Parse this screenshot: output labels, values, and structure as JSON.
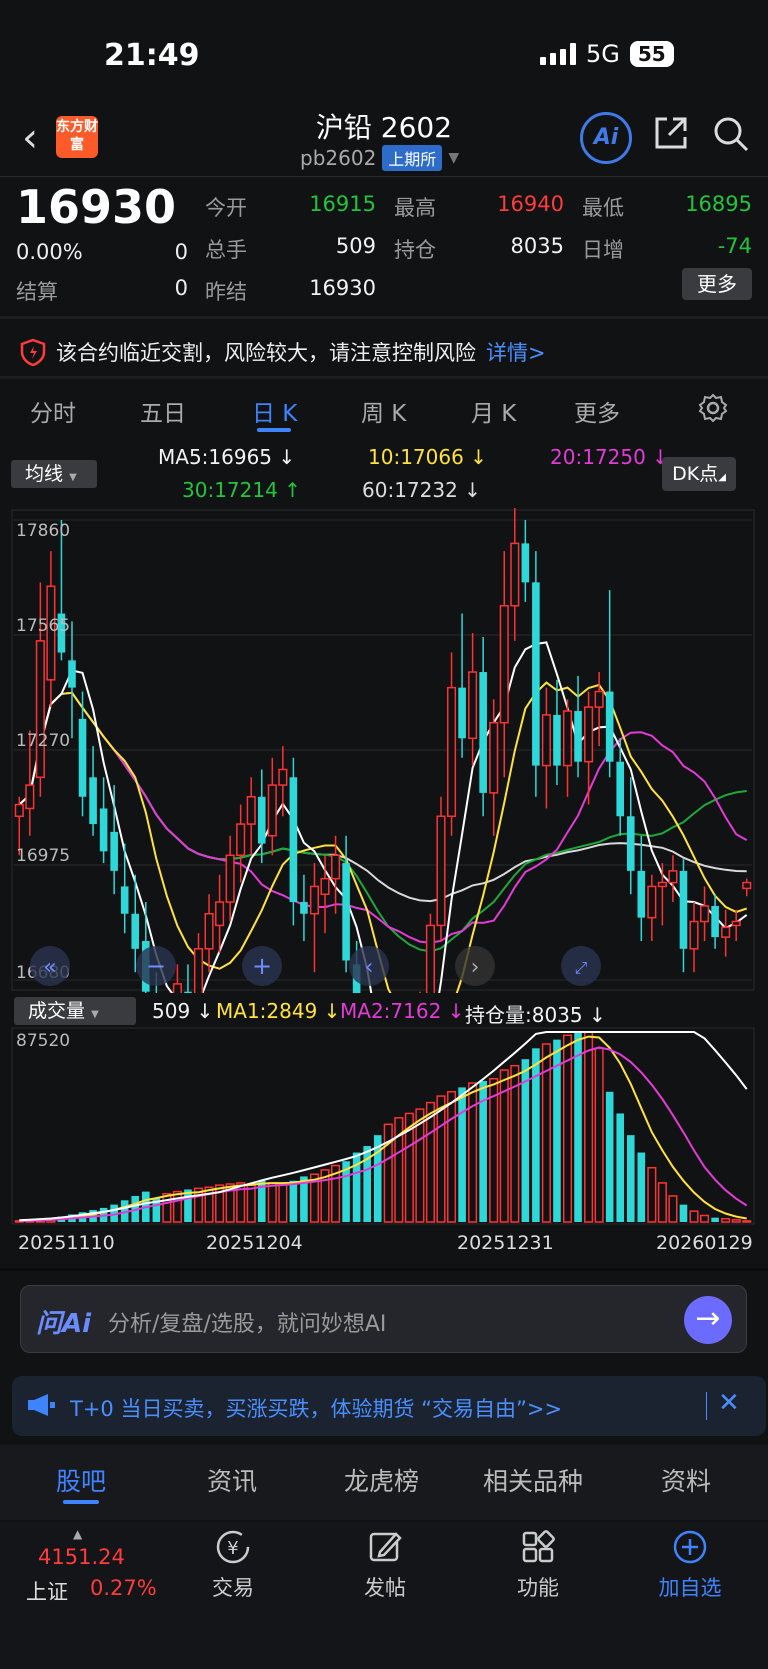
{
  "status": {
    "time": "21:49",
    "network": "5G",
    "battery": "55"
  },
  "header": {
    "title": "沪铅 2602",
    "code": "pb2602",
    "exchange": "上期所",
    "logo_text": "东方财富",
    "ai_label": "Ai"
  },
  "quote": {
    "last": "16930",
    "change_pct": "0.00%",
    "change": "0",
    "settle_label": "结算",
    "settle": "0",
    "fields": [
      {
        "label": "今开",
        "value": "16915",
        "color": "green"
      },
      {
        "label": "最高",
        "value": "16940",
        "color": "red"
      },
      {
        "label": "最低",
        "value": "16895",
        "color": "green"
      },
      {
        "label": "总手",
        "value": "509",
        "color": "white"
      },
      {
        "label": "持仓",
        "value": "8035",
        "color": "white"
      },
      {
        "label": "日增",
        "value": "-74",
        "color": "green"
      },
      {
        "label": "昨结",
        "value": "16930",
        "color": "white"
      }
    ],
    "more_label": "更多"
  },
  "risk": {
    "text": "该合约临近交割，风险较大，请注意控制风险",
    "detail": "详情>"
  },
  "tabs": [
    "分时",
    "五日",
    "日 K",
    "周 K",
    "月 K",
    "更多"
  ],
  "active_tab": "日 K",
  "indicators": {
    "ma_select": "均线",
    "ma5": "MA5:16965 ↓",
    "ma10": "10:17066 ↓",
    "ma20": "20:17250 ↓",
    "ma30": "30:17214 ↑",
    "ma60": "60:17232 ↓",
    "dk_label": "DK点"
  },
  "volume": {
    "select": "成交量",
    "vol": "509 ↓",
    "ma1": "MA1:2849 ↓",
    "ma2": "MA2:7162 ↓",
    "oi": "持仓量:8035 ↓"
  },
  "chart_data": {
    "type": "candlestick",
    "y_ticks": [
      "17860",
      "17565",
      "17270",
      "16975",
      "16680"
    ],
    "ylim": [
      16680,
      17860
    ],
    "vol_ylim": [
      0,
      87520
    ],
    "vol_tick": "87520",
    "x_labels": [
      "20251110",
      "20251204",
      "20251231",
      "20260129"
    ],
    "candles": [
      [
        17100,
        17150,
        17000,
        17130
      ],
      [
        17120,
        17320,
        17050,
        17180
      ],
      [
        17200,
        17700,
        17150,
        17550
      ],
      [
        17450,
        17780,
        17380,
        17690
      ],
      [
        17620,
        17860,
        17500,
        17520
      ],
      [
        17500,
        17600,
        17300,
        17430
      ],
      [
        17350,
        17420,
        17100,
        17150
      ],
      [
        17200,
        17280,
        17050,
        17080
      ],
      [
        17120,
        17200,
        16980,
        17010
      ],
      [
        17060,
        17180,
        16900,
        16960
      ],
      [
        16920,
        17030,
        16800,
        16850
      ],
      [
        16850,
        16950,
        16700,
        16760
      ],
      [
        16780,
        16880,
        16620,
        16650
      ],
      [
        16600,
        16700,
        16350,
        16500
      ],
      [
        16500,
        16620,
        16250,
        16560
      ],
      [
        16560,
        16720,
        16450,
        16670
      ],
      [
        16650,
        16720,
        16500,
        16610
      ],
      [
        16580,
        16800,
        16550,
        16760
      ],
      [
        16760,
        16900,
        16700,
        16850
      ],
      [
        16820,
        16950,
        16750,
        16880
      ],
      [
        16880,
        17050,
        16830,
        17000
      ],
      [
        17000,
        17130,
        16930,
        17080
      ],
      [
        17080,
        17200,
        17000,
        17150
      ],
      [
        17150,
        17220,
        16980,
        17030
      ],
      [
        17050,
        17250,
        17000,
        17180
      ],
      [
        17180,
        17280,
        17100,
        17220
      ],
      [
        17200,
        17250,
        16820,
        16880
      ],
      [
        16880,
        16950,
        16780,
        16850
      ],
      [
        16850,
        16980,
        16700,
        16920
      ],
      [
        16900,
        17000,
        16800,
        16940
      ],
      [
        16940,
        17050,
        16850,
        17000
      ],
      [
        16980,
        17050,
        16700,
        16730
      ],
      [
        16720,
        16780,
        16450,
        16490
      ],
      [
        16480,
        16560,
        16350,
        16380
      ],
      [
        16380,
        16450,
        16080,
        16150
      ],
      [
        16150,
        16280,
        16060,
        16230
      ],
      [
        16230,
        16400,
        16150,
        16380
      ],
      [
        16380,
        16520,
        16300,
        16460
      ],
      [
        16460,
        16650,
        16400,
        16620
      ],
      [
        16620,
        16850,
        16560,
        16820
      ],
      [
        16820,
        17150,
        16780,
        17100
      ],
      [
        17100,
        17520,
        17050,
        17430
      ],
      [
        17430,
        17620,
        17250,
        17300
      ],
      [
        17300,
        17570,
        17230,
        17470
      ],
      [
        17470,
        17560,
        17100,
        17160
      ],
      [
        17160,
        17400,
        17050,
        17340
      ],
      [
        17340,
        17780,
        17200,
        17640
      ],
      [
        17640,
        17900,
        17550,
        17800
      ],
      [
        17800,
        17860,
        17650,
        17700
      ],
      [
        17700,
        17780,
        17150,
        17230
      ],
      [
        17230,
        17430,
        17120,
        17360
      ],
      [
        17360,
        17450,
        17180,
        17230
      ],
      [
        17230,
        17400,
        17150,
        17370
      ],
      [
        17370,
        17460,
        17200,
        17240
      ],
      [
        17240,
        17420,
        17130,
        17380
      ],
      [
        17380,
        17470,
        17280,
        17420
      ],
      [
        17420,
        17680,
        17200,
        17240
      ],
      [
        17240,
        17300,
        17050,
        17100
      ],
      [
        17100,
        17200,
        16900,
        16960
      ],
      [
        16960,
        17050,
        16780,
        16840
      ],
      [
        16840,
        16950,
        16780,
        16920
      ],
      [
        16920,
        16980,
        16820,
        16930
      ],
      [
        16930,
        17000,
        16880,
        16960
      ],
      [
        16960,
        16990,
        16700,
        16760
      ],
      [
        16760,
        16880,
        16700,
        16830
      ],
      [
        16830,
        16920,
        16780,
        16870
      ],
      [
        16870,
        16900,
        16760,
        16790
      ],
      [
        16790,
        16860,
        16740,
        16815
      ],
      [
        16820,
        16860,
        16780,
        16830
      ],
      [
        16915,
        16940,
        16895,
        16930
      ]
    ],
    "volumes": [
      500,
      800,
      1200,
      1500,
      2500,
      3500,
      4500,
      5500,
      6500,
      8000,
      10000,
      12000,
      14000,
      11000,
      13000,
      14000,
      15000,
      15500,
      16000,
      17000,
      17500,
      18000,
      17000,
      19000,
      18000,
      17500,
      19000,
      21000,
      22000,
      24000,
      26000,
      28000,
      32000,
      35000,
      40000,
      45000,
      48000,
      50000,
      52000,
      55000,
      58000,
      60000,
      62000,
      64000,
      65000,
      66000,
      70000,
      72000,
      75000,
      80000,
      82000,
      84000,
      86000,
      87520,
      87520,
      80000,
      60000,
      50000,
      40000,
      32000,
      25000,
      18000,
      12000,
      8000,
      5000,
      3000,
      2000,
      1500,
      1000,
      509
    ]
  },
  "ask": {
    "logo": "问Ai",
    "placeholder": "分析/复盘/选股，就问妙想AI"
  },
  "promo": {
    "text": "T+0 当日买卖，买涨买跌，体验期货 “交易自由”>>"
  },
  "subtabs": [
    "股吧",
    "资讯",
    "龙虎榜",
    "相关品种",
    "资料"
  ],
  "nav": {
    "index_value": "4151.24",
    "index_name": "上证",
    "index_change": "0.27%",
    "items": [
      "交易",
      "发帖",
      "功能",
      "加自选"
    ]
  }
}
